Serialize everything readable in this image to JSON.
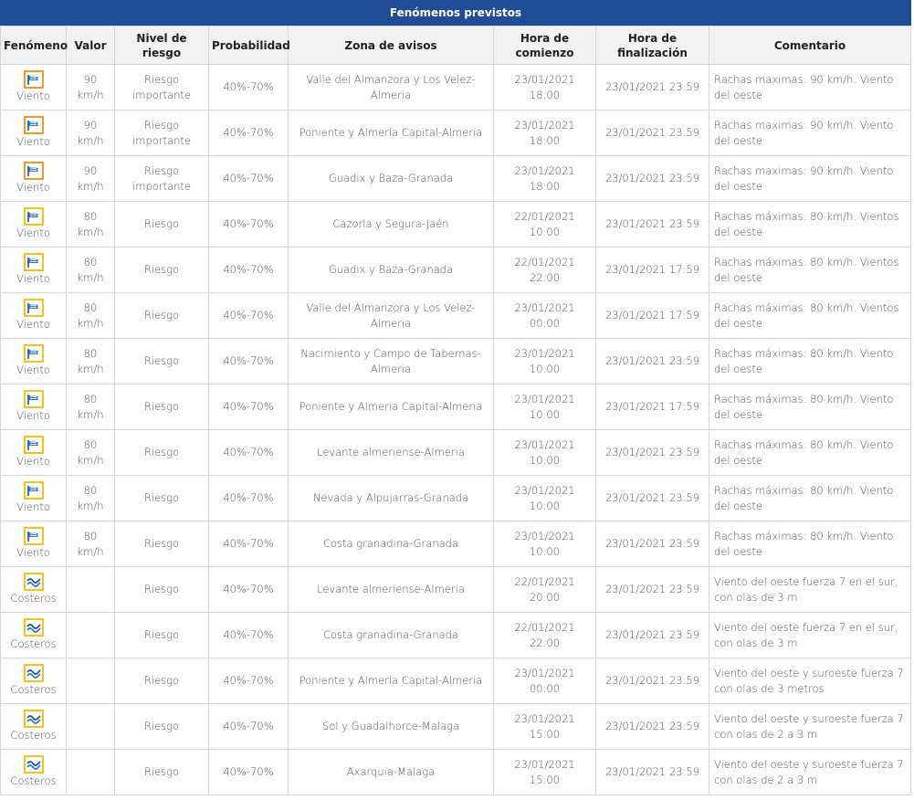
{
  "table": {
    "title": "Fenómenos previstos",
    "headers": {
      "phenomenon": "Fenómeno",
      "value": "Valor",
      "level": "Nivel de riesgo",
      "probability": "Probabilidad",
      "zone": "Zona de avisos",
      "start": "Hora de comienzo",
      "end": "Hora de finalización",
      "comment": "Comentario"
    },
    "rows": [
      {
        "icon": "wind-icon",
        "icon_color": "#f29b21",
        "phenomenon": "Viento",
        "value": "90 km/h",
        "level": "Riesgo importante",
        "probability": "40%-70%",
        "zone": "Valle del Almanzora y Los Velez-Almeria",
        "start": "23/01/2021 18:00",
        "end": "23/01/2021 23:59",
        "comment": "Rachas maximas: 90 km/h. Viento del oeste"
      },
      {
        "icon": "wind-icon",
        "icon_color": "#f29b21",
        "phenomenon": "Viento",
        "value": "90 km/h",
        "level": "Riesgo importante",
        "probability": "40%-70%",
        "zone": "Poniente y Almeria Capital-Almeria",
        "start": "23/01/2021 18:00",
        "end": "23/01/2021 23:59",
        "comment": "Rachas maximas: 90 km/h. Viento del oeste"
      },
      {
        "icon": "wind-icon",
        "icon_color": "#f29b21",
        "phenomenon": "Viento",
        "value": "90 km/h",
        "level": "Riesgo importante",
        "probability": "40%-70%",
        "zone": "Guadix y Baza-Granada",
        "start": "23/01/2021 18:00",
        "end": "23/01/2021 23:59",
        "comment": "Rachas maximas: 90 km/h. Viento del oeste"
      },
      {
        "icon": "wind-icon",
        "icon_color": "#f4c21a",
        "phenomenon": "Viento",
        "value": "80 km/h",
        "level": "Riesgo",
        "probability": "40%-70%",
        "zone": "Cazorla y Segura-Jaén",
        "start": "22/01/2021 10:00",
        "end": "23/01/2021 23:59",
        "comment": "Rachas máximas: 80 km/h. Vientos del oeste"
      },
      {
        "icon": "wind-icon",
        "icon_color": "#f4c21a",
        "phenomenon": "Viento",
        "value": "80 km/h",
        "level": "Riesgo",
        "probability": "40%-70%",
        "zone": "Guadix y Baza-Granada",
        "start": "22/01/2021 22:00",
        "end": "23/01/2021 17:59",
        "comment": "Rachas máximas: 80 km/h. Vientos del oeste"
      },
      {
        "icon": "wind-icon",
        "icon_color": "#f4c21a",
        "phenomenon": "Viento",
        "value": "80 km/h",
        "level": "Riesgo",
        "probability": "40%-70%",
        "zone": "Valle del Almanzora y Los Velez-Almeria",
        "start": "23/01/2021 00:00",
        "end": "23/01/2021 17:59",
        "comment": "Rachas máximas: 80 km/h. Vientos del oeste"
      },
      {
        "icon": "wind-icon",
        "icon_color": "#f4c21a",
        "phenomenon": "Viento",
        "value": "80 km/h",
        "level": "Riesgo",
        "probability": "40%-70%",
        "zone": "Nacimiento y Campo de Tabernas-Almeria",
        "start": "23/01/2021 10:00",
        "end": "23/01/2021 23:59",
        "comment": "Rachas máximas: 80 km/h. Viento del oeste"
      },
      {
        "icon": "wind-icon",
        "icon_color": "#f4c21a",
        "phenomenon": "Viento",
        "value": "80 km/h",
        "level": "Riesgo",
        "probability": "40%-70%",
        "zone": "Poniente y Almeria Capital-Almeria",
        "start": "23/01/2021 10:00",
        "end": "23/01/2021 17:59",
        "comment": "Rachas máximas: 80 km/h. Viento del oeste"
      },
      {
        "icon": "wind-icon",
        "icon_color": "#f4c21a",
        "phenomenon": "Viento",
        "value": "80 km/h",
        "level": "Riesgo",
        "probability": "40%-70%",
        "zone": "Levante almeriense-Almeria",
        "start": "23/01/2021 10:00",
        "end": "23/01/2021 23:59",
        "comment": "Rachas máximas: 80 km/h. Viento del oeste"
      },
      {
        "icon": "wind-icon",
        "icon_color": "#f4c21a",
        "phenomenon": "Viento",
        "value": "80 km/h",
        "level": "Riesgo",
        "probability": "40%-70%",
        "zone": "Nevada y Alpujarras-Granada",
        "start": "23/01/2021 10:00",
        "end": "23/01/2021 23:59",
        "comment": "Rachas máximas: 80 km/h. Viento del oeste"
      },
      {
        "icon": "wind-icon",
        "icon_color": "#f4c21a",
        "phenomenon": "Viento",
        "value": "80 km/h",
        "level": "Riesgo",
        "probability": "40%-70%",
        "zone": "Costa granadina-Granada",
        "start": "23/01/2021 10:00",
        "end": "23/01/2021 23:59",
        "comment": "Rachas máximas: 80 km/h. Viento del oeste"
      },
      {
        "icon": "wave-icon",
        "icon_color": "#f4c21a",
        "phenomenon": "Costeros",
        "value": "",
        "level": "Riesgo",
        "probability": "40%-70%",
        "zone": "Levante almeriense-Almeria",
        "start": "22/01/2021 20:00",
        "end": "23/01/2021 23:59",
        "comment": "Viento del oeste fuerza 7 en el sur, con olas de 3 m"
      },
      {
        "icon": "wave-icon",
        "icon_color": "#f4c21a",
        "phenomenon": "Costeros",
        "value": "",
        "level": "Riesgo",
        "probability": "40%-70%",
        "zone": "Costa granadina-Granada",
        "start": "22/01/2021 22:00",
        "end": "23/01/2021 23:59",
        "comment": "Viento del oeste fuerza 7 en el sur, con olas de 3 m"
      },
      {
        "icon": "wave-icon",
        "icon_color": "#f4c21a",
        "phenomenon": "Costeros",
        "value": "",
        "level": "Riesgo",
        "probability": "40%-70%",
        "zone": "Poniente y Almeria Capital-Almeria",
        "start": "23/01/2021 00:00",
        "end": "23/01/2021 23:59",
        "comment": "Viento del oeste y suroeste fuerza 7 con olas de 3 metros"
      },
      {
        "icon": "wave-icon",
        "icon_color": "#f4c21a",
        "phenomenon": "Costeros",
        "value": "",
        "level": "Riesgo",
        "probability": "40%-70%",
        "zone": "Sol y Guadalhorce-Malaga",
        "start": "23/01/2021 15:00",
        "end": "23/01/2021 23:59",
        "comment": "Viento del oeste y suroeste fuerza 7 con olas de 2 a 3 m"
      },
      {
        "icon": "wave-icon",
        "icon_color": "#f4c21a",
        "phenomenon": "Costeros",
        "value": "",
        "level": "Riesgo",
        "probability": "40%-70%",
        "zone": "Axarquia-Malaga",
        "start": "23/01/2021 15:00",
        "end": "23/01/2021 23:59",
        "comment": "Viento del oeste y suroeste fuerza 7 con olas de 2 a 3 m"
      }
    ]
  }
}
